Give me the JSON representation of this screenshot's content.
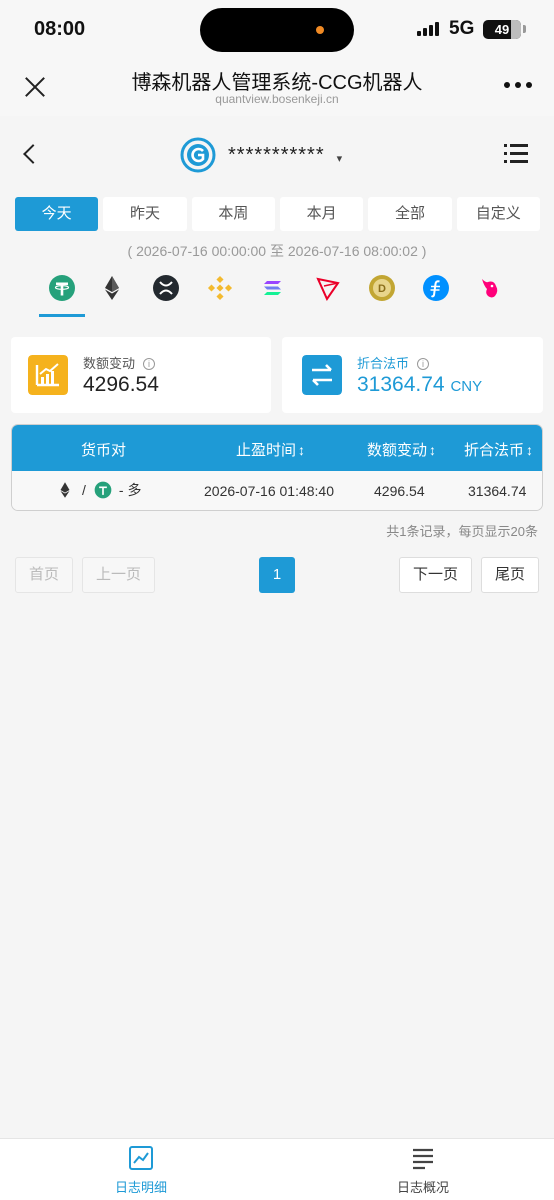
{
  "status_bar": {
    "time": "08:00",
    "network": "5G",
    "battery": "49"
  },
  "browser": {
    "title": "博森机器人管理系统-CCG机器人",
    "url": "quantview.bosenkeji.cn"
  },
  "header": {
    "account_name": "***********",
    "caret": "▾"
  },
  "colors": {
    "accent": "#1e9ad6",
    "orange": "#f5b21d",
    "usdt_green": "#26a17b"
  },
  "tabs": [
    {
      "label": "今天",
      "active": true
    },
    {
      "label": "昨天",
      "active": false
    },
    {
      "label": "本周",
      "active": false
    },
    {
      "label": "本月",
      "active": false
    },
    {
      "label": "全部",
      "active": false
    },
    {
      "label": "自定义",
      "active": false
    }
  ],
  "date_range": "( 2026-07-16 00:00:00 至 2026-07-16 08:00:02 )",
  "coins": [
    "usdt-icon",
    "eth-icon",
    "xrp-icon",
    "bnb-icon",
    "sol-icon",
    "trx-icon",
    "doge-icon",
    "fil-icon",
    "uni-icon"
  ],
  "stats": {
    "amount_change": {
      "label": "数额变动",
      "value": "4296.54"
    },
    "fiat": {
      "label": "折合法币",
      "value": "31364.74",
      "unit": "CNY"
    },
    "info_glyph": "i"
  },
  "table": {
    "headers": [
      "货币对",
      "止盈时间",
      "数额变动",
      "折合法币"
    ],
    "sort_glyph": "↕",
    "rows": [
      {
        "pair_sep": "/",
        "direction": "- 多",
        "time": "2026-07-16 01:48:40",
        "amount": "4296.54",
        "fiat": "31364.74"
      }
    ]
  },
  "record_info": "共1条记录，每页显示20条",
  "pagination": {
    "first": "首页",
    "prev": "上一页",
    "current": "1",
    "next": "下一页",
    "last": "尾页"
  },
  "bottom_nav": [
    {
      "label": "日志明细",
      "active": true
    },
    {
      "label": "日志概况",
      "active": false
    }
  ]
}
